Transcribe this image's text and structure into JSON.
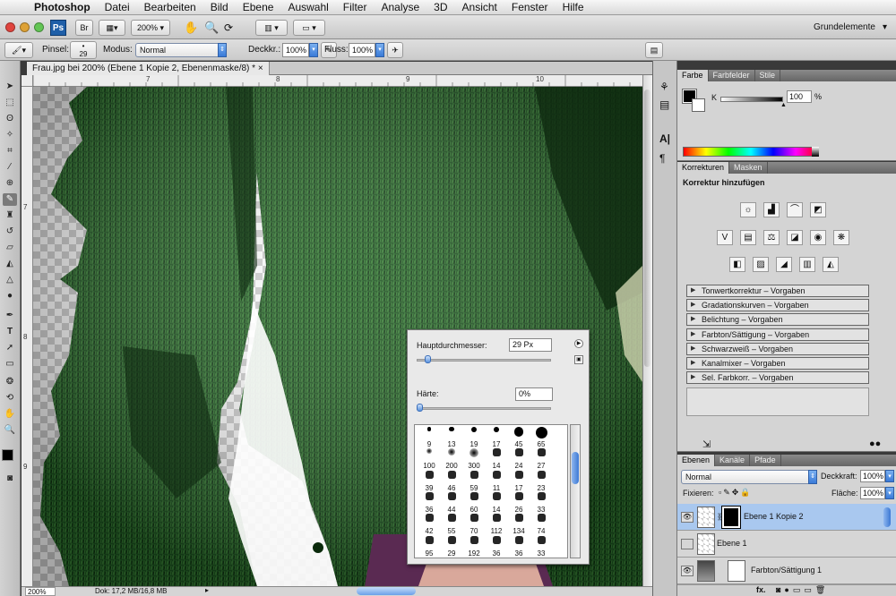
{
  "menubar": {
    "apple": "",
    "app": "Photoshop",
    "items": [
      "Datei",
      "Bearbeiten",
      "Bild",
      "Ebene",
      "Auswahl",
      "Filter",
      "Analyse",
      "3D",
      "Ansicht",
      "Fenster",
      "Hilfe"
    ]
  },
  "appbar": {
    "ps_logo": "Ps",
    "br_logo": "Br",
    "zoom": "200%",
    "workspace": "Grundelemente"
  },
  "options": {
    "brush_label": "Pinsel:",
    "brush_size": "29",
    "mode_label": "Modus:",
    "mode_value": "Normal",
    "opacity_label": "Deckkr.:",
    "opacity_value": "100%",
    "flow_label": "Fluss:",
    "flow_value": "100%"
  },
  "document": {
    "tab_title": "Frau.jpg bei 200% (Ebene 1 Kopie 2, Ebenenmaske/8) *",
    "close": "×"
  },
  "rulers": {
    "top": [
      "7",
      "8",
      "9",
      "10"
    ],
    "left": [
      "7",
      "8",
      "9"
    ]
  },
  "status": {
    "zoom": "200%",
    "doc": "Dok: 17,2 MB/16,8 MB"
  },
  "brush_popup": {
    "diameter_label": "Hauptdurchmesser:",
    "diameter_value": "29 Px",
    "hardness_label": "Härte:",
    "hardness_value": "0%",
    "diameter_level": 0.08,
    "hardness_level": 0.0,
    "rows": [
      [
        "9",
        "13",
        "19",
        "17",
        "45",
        "65"
      ],
      [
        "100",
        "200",
        "300",
        "14",
        "24",
        "27"
      ],
      [
        "39",
        "46",
        "59",
        "11",
        "17",
        "23"
      ],
      [
        "36",
        "44",
        "60",
        "14",
        "26",
        "33"
      ],
      [
        "42",
        "55",
        "70",
        "112",
        "134",
        "74"
      ],
      [
        "95",
        "29",
        "192",
        "36",
        "36",
        "33"
      ]
    ]
  },
  "color_panel": {
    "tabs": [
      "Farbe",
      "Farbfelder",
      "Stile"
    ],
    "k_label": "K",
    "k_value": "100",
    "unit": "%",
    "k_level": 1.0
  },
  "adjust_panel": {
    "tabs": [
      "Korrekturen",
      "Masken"
    ],
    "heading": "Korrektur hinzufügen",
    "presets": [
      "Tonwertkorrektur – Vorgaben",
      "Gradationskurven – Vorgaben",
      "Belichtung – Vorgaben",
      "Farbton/Sättigung – Vorgaben",
      "Schwarzweiß – Vorgaben",
      "Kanalmixer – Vorgaben",
      "Sel. Farbkorr. – Vorgaben"
    ]
  },
  "layers_panel": {
    "tabs": [
      "Ebenen",
      "Kanäle",
      "Pfade"
    ],
    "blend": "Normal",
    "opacity_label": "Deckkraft:",
    "opacity_value": "100%",
    "lock_label": "Fixieren:",
    "fill_label": "Fläche:",
    "fill_value": "100%",
    "layers": [
      "Ebene 1 Kopie 2",
      "Ebene 1",
      "Farbton/Sättigung 1"
    ],
    "footer": "fx."
  },
  "colors": {
    "accent": "#3a7ad8",
    "selected_layer": "#a9c8ef",
    "grass": "#1e5a22"
  }
}
